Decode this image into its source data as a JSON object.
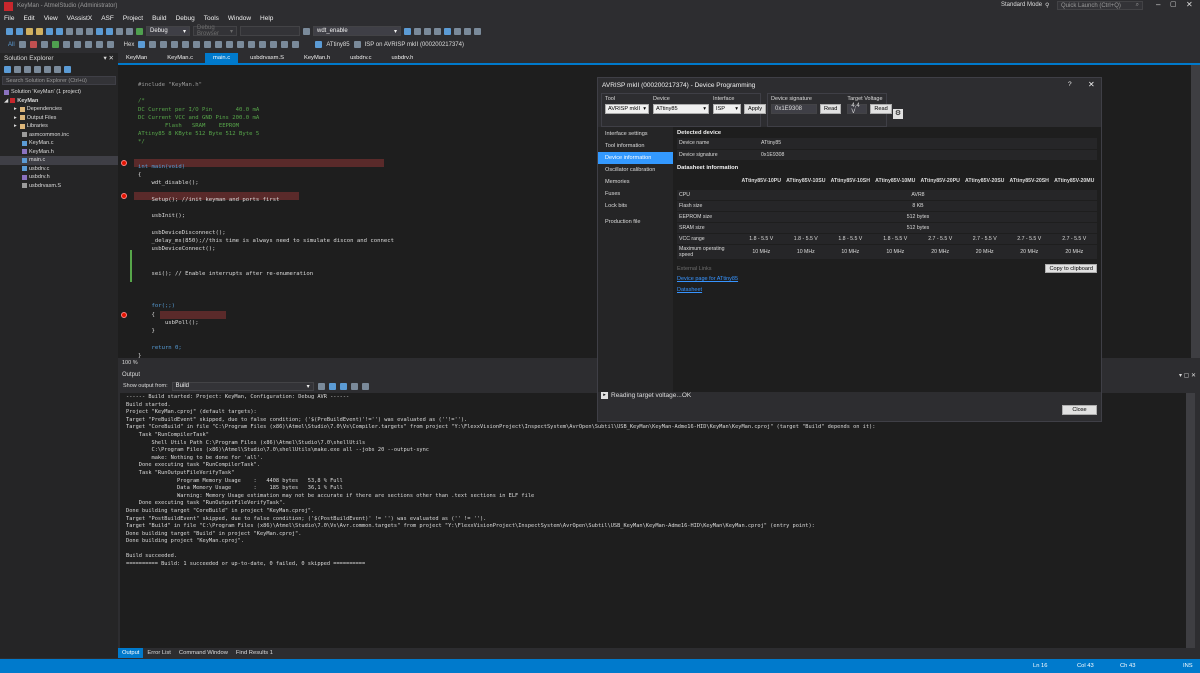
{
  "window": {
    "title": "KeyMan - AtmelStudio (Administrator)",
    "mode": "Standard Mode",
    "quick_launch": "Quick Launch (Ctrl+Q)"
  },
  "menu": [
    "File",
    "Edit",
    "View",
    "VAssistX",
    "ASF",
    "Project",
    "Build",
    "Debug",
    "Tools",
    "Window",
    "Help"
  ],
  "toolbar": {
    "config": "Debug",
    "debug_browser": "Debug Browser",
    "find_combo": "wdt_enable",
    "device": "ATtiny85",
    "tool": "ISP on AVRISP mkII (000200217374)",
    "hex_label": "Hex"
  },
  "solution_explorer": {
    "title": "Solution Explorer",
    "search_placeholder": "Search Solution Explorer (Ctrl+ü)",
    "items": [
      {
        "label": "Solution 'KeyMan' (1 project)",
        "icon": "solution-icon"
      },
      {
        "label": "KeyMan",
        "icon": "project-icon"
      },
      {
        "label": "Dependencies",
        "icon": "folder-icon"
      },
      {
        "label": "Output Files",
        "icon": "folder-icon"
      },
      {
        "label": "Libraries",
        "icon": "folder-icon"
      },
      {
        "label": "asmcommon.inc",
        "icon": "file-icon"
      },
      {
        "label": "KeyMan.c",
        "icon": "c-file-icon"
      },
      {
        "label": "KeyMan.h",
        "icon": "h-file-icon"
      },
      {
        "label": "main.c",
        "icon": "c-file-icon"
      },
      {
        "label": "usbdrv.c",
        "icon": "c-file-icon"
      },
      {
        "label": "usbdrv.h",
        "icon": "h-file-icon"
      },
      {
        "label": "usbdrvasm.S",
        "icon": "file-icon"
      }
    ]
  },
  "tabs": [
    "KeyMan",
    "KeyMan.c",
    "main.c",
    "usbdrvasm.S",
    "KeyMan.h",
    "usbdrv.c",
    "usbdrv.h"
  ],
  "active_tab": "main.c",
  "editor": {
    "zoom": "100 %",
    "lines": [
      "#include \"KeyMan.h\"",
      "",
      "/*",
      "DC Current per I/O Pin       40.0 mA",
      "DC Current VCC and GND Pins 200.0 mA",
      "        Flash   SRAM    EEPROM",
      "ATtiny85 8 KByte 512 Byte 512 Byte 5",
      "*/",
      "",
      "",
      "int main(void)",
      "{",
      "    wdt_disable();",
      "",
      "    Setup(); //init keyman and ports first",
      "",
      "    usbInit();",
      "",
      "    usbDeviceDisconnect();",
      "    _delay_ms(850);//this time is always need to simulate discon and connect",
      "    usbDeviceConnect();",
      "",
      "",
      "    sei(); // Enable interrupts after re-enumeration",
      "",
      "",
      "",
      "    for(;;)",
      "    {",
      "        usbPoll();",
      "    }",
      "",
      "    return 0;",
      "}"
    ]
  },
  "output": {
    "title": "Output",
    "show_from_label": "Show output from:",
    "show_from": "Build",
    "lines": [
      "------ Build started: Project: KeyMan, Configuration: Debug AVR ------",
      "Build started.",
      "Project \"KeyMan.cproj\" (default targets):",
      "Target \"PreBuildEvent\" skipped, due to false condition; ('$(PreBuildEvent)'!='') was evaluated as (''!='').",
      "Target \"CoreBuild\" in file \"C:\\Program Files (x86)\\Atmel\\Studio\\7.0\\Vs\\Compiler.targets\" from project \"Y:\\FlexxVisionProject\\InspectSystem\\AvrOpen\\Subtil\\USB_KeyMan\\KeyMan-Adme16-HID\\KeyMan\\KeyMan.cproj\" (target \"Build\" depends on it):",
      "    Task \"RunCompilerTask\"",
      "        Shell Utils Path C:\\Program Files (x86)\\Atmel\\Studio\\7.0\\shellUtils",
      "        C:\\Program Files (x86)\\Atmel\\Studio\\7.0\\shellUtils\\make.exe all --jobs 20 --output-sync",
      "        make: Nothing to be done for 'all'.",
      "    Done executing task \"RunCompilerTask\".",
      "    Task \"RunOutputFileVerifyTask\"",
      "                Program Memory Usage    :   4408 bytes   53,8 % Full",
      "                Data Memory Usage       :    185 bytes   36,1 % Full",
      "                Warning: Memory Usage estimation may not be accurate if there are sections other than .text sections in ELF file",
      "    Done executing task \"RunOutputFileVerifyTask\".",
      "Done building target \"CoreBuild\" in project \"KeyMan.cproj\".",
      "Target \"PostBuildEvent\" skipped, due to false condition; ('$(PostBuildEvent)' != '') was evaluated as ('' != '').",
      "Target \"Build\" in file \"C:\\Program Files (x86)\\Atmel\\Studio\\7.0\\Vs\\Avr.common.targets\" from project \"Y:\\FlexxVisionProject\\InspectSystem\\AvrOpen\\Subtil\\USB_KeyMan\\KeyMan-Adme16-HID\\KeyMan\\KeyMan.cproj\" (entry point):",
      "Done building target \"Build\" in project \"KeyMan.cproj\".",
      "Done building project \"KeyMan.cproj\".",
      "",
      "Build succeeded.",
      "========== Build: 1 succeeded or up-to-date, 0 failed, 0 skipped =========="
    ],
    "tabs": [
      "Output",
      "Error List",
      "Command Window",
      "Find Results 1"
    ]
  },
  "status": {
    "ln": "Ln 16",
    "col": "Col 43",
    "ch": "Ch 43",
    "ins": "INS"
  },
  "dialog": {
    "title": "AVRISP mkII (000200217374) - Device Programming",
    "help": "?",
    "tool_label": "Tool",
    "tool": "AVRISP mkII",
    "device_label": "Device",
    "device": "ATtiny85",
    "interface_label": "Interface",
    "interface": "ISP",
    "apply": "Apply",
    "sig_label": "Device signature",
    "sig_value": "0x1E9308",
    "read": "Read",
    "voltage_label": "Target Voltage",
    "voltage": "4,4 V",
    "nav": [
      "Interface settings",
      "Tool information",
      "Device information",
      "Oscillator calibration",
      "Memories",
      "Fuses",
      "Lock bits",
      "Production file"
    ],
    "nav_active": "Device information",
    "detected_title": "Detected device",
    "detected": [
      [
        "Device name",
        "ATtiny85"
      ],
      [
        "Device signature",
        "0x1E9308"
      ]
    ],
    "datasheet_title": "Datasheet information",
    "ds_cols": [
      "ATtiny85V-10PU",
      "ATtiny85V-10SU",
      "ATtiny85V-10SH",
      "ATtiny85V-10MU",
      "ATtiny85V-20PU",
      "ATtiny85V-20SU",
      "ATtiny85V-20SH",
      "ATtiny85V-20MU"
    ],
    "cpu": [
      "CPU",
      "AVR8"
    ],
    "flash": [
      "Flash size",
      "8 KB"
    ],
    "eeprom": [
      "EEPROM size",
      "512 bytes"
    ],
    "sram": [
      "SRAM size",
      "512 bytes"
    ],
    "vcc": {
      "label": "VCC range",
      "values": [
        "1.8 - 5.5 V",
        "1.8 - 5.5 V",
        "1.8 - 5.5 V",
        "1.8 - 5.5 V",
        "2.7 - 5.5 V",
        "2.7 - 5.5 V",
        "2.7 - 5.5 V",
        "2.7 - 5.5 V"
      ]
    },
    "speed": {
      "label": "Maximum operating speed",
      "values": [
        "10 MHz",
        "10 MHz",
        "10 MHz",
        "10 MHz",
        "20 MHz",
        "20 MHz",
        "20 MHz",
        "20 MHz"
      ]
    },
    "external_links": "External Links",
    "copy": "Copy to clipboard",
    "link_device": "Device page for ATtiny85",
    "link_datasheet": "Datasheet",
    "status_text": "Reading target voltage...OK",
    "close": "Close"
  }
}
